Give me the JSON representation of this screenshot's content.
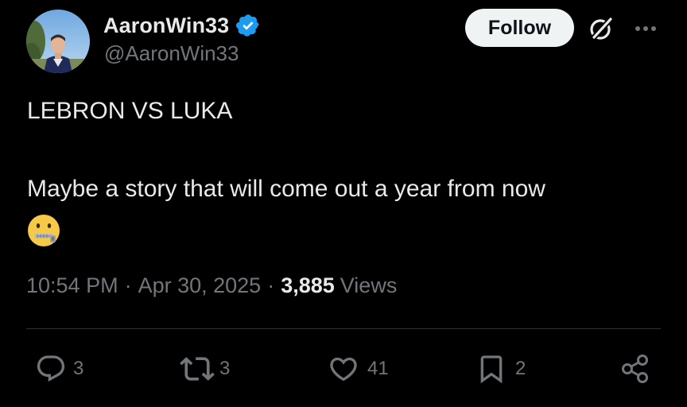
{
  "author": {
    "display_name": "AaronWin33",
    "handle": "@AaronWin33",
    "verified": true
  },
  "header": {
    "follow_label": "Follow",
    "grok_icon": "grok-icon",
    "more_icon": "more-options-icon"
  },
  "tweet": {
    "line_1": "LEBRON VS LUKA",
    "line_2": "Maybe a story that will come out a year from now",
    "emoji": "zipper-mouth-face"
  },
  "meta": {
    "time": "10:54 PM",
    "date": "Apr 30, 2025",
    "separator": "·",
    "views_count": "3,885",
    "views_label": "Views"
  },
  "actions": {
    "replies": "3",
    "reposts": "3",
    "likes": "41",
    "bookmarks": "2"
  },
  "colors": {
    "background": "#000000",
    "text_primary": "#e7e9ea",
    "text_secondary": "#71767b",
    "verified_blue": "#1d9bf0",
    "follow_bg": "#eff3f4",
    "divider": "#2f3336"
  }
}
